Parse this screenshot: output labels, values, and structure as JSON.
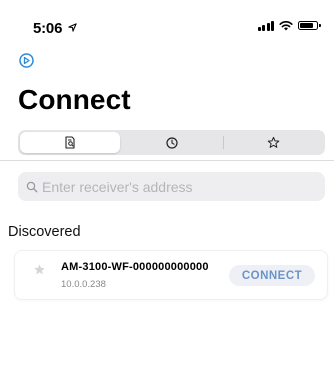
{
  "status_bar": {
    "time": "5:06"
  },
  "header": {
    "title": "Connect"
  },
  "tabs": [
    {
      "icon": "receipt-search-icon",
      "active": true
    },
    {
      "icon": "clock-icon",
      "active": false
    },
    {
      "icon": "star-icon",
      "active": false
    }
  ],
  "search": {
    "placeholder": "Enter receiver's address",
    "value": ""
  },
  "discovered": {
    "header": "Discovered",
    "devices": [
      {
        "name": "AM-3100-WF-000000000000",
        "ip": "10.0.0.238",
        "action_label": "CONNECT"
      }
    ]
  },
  "colors": {
    "accent": "#2b8ad8",
    "connect_text": "#6a94c8",
    "connect_bg": "#eef0f6"
  }
}
